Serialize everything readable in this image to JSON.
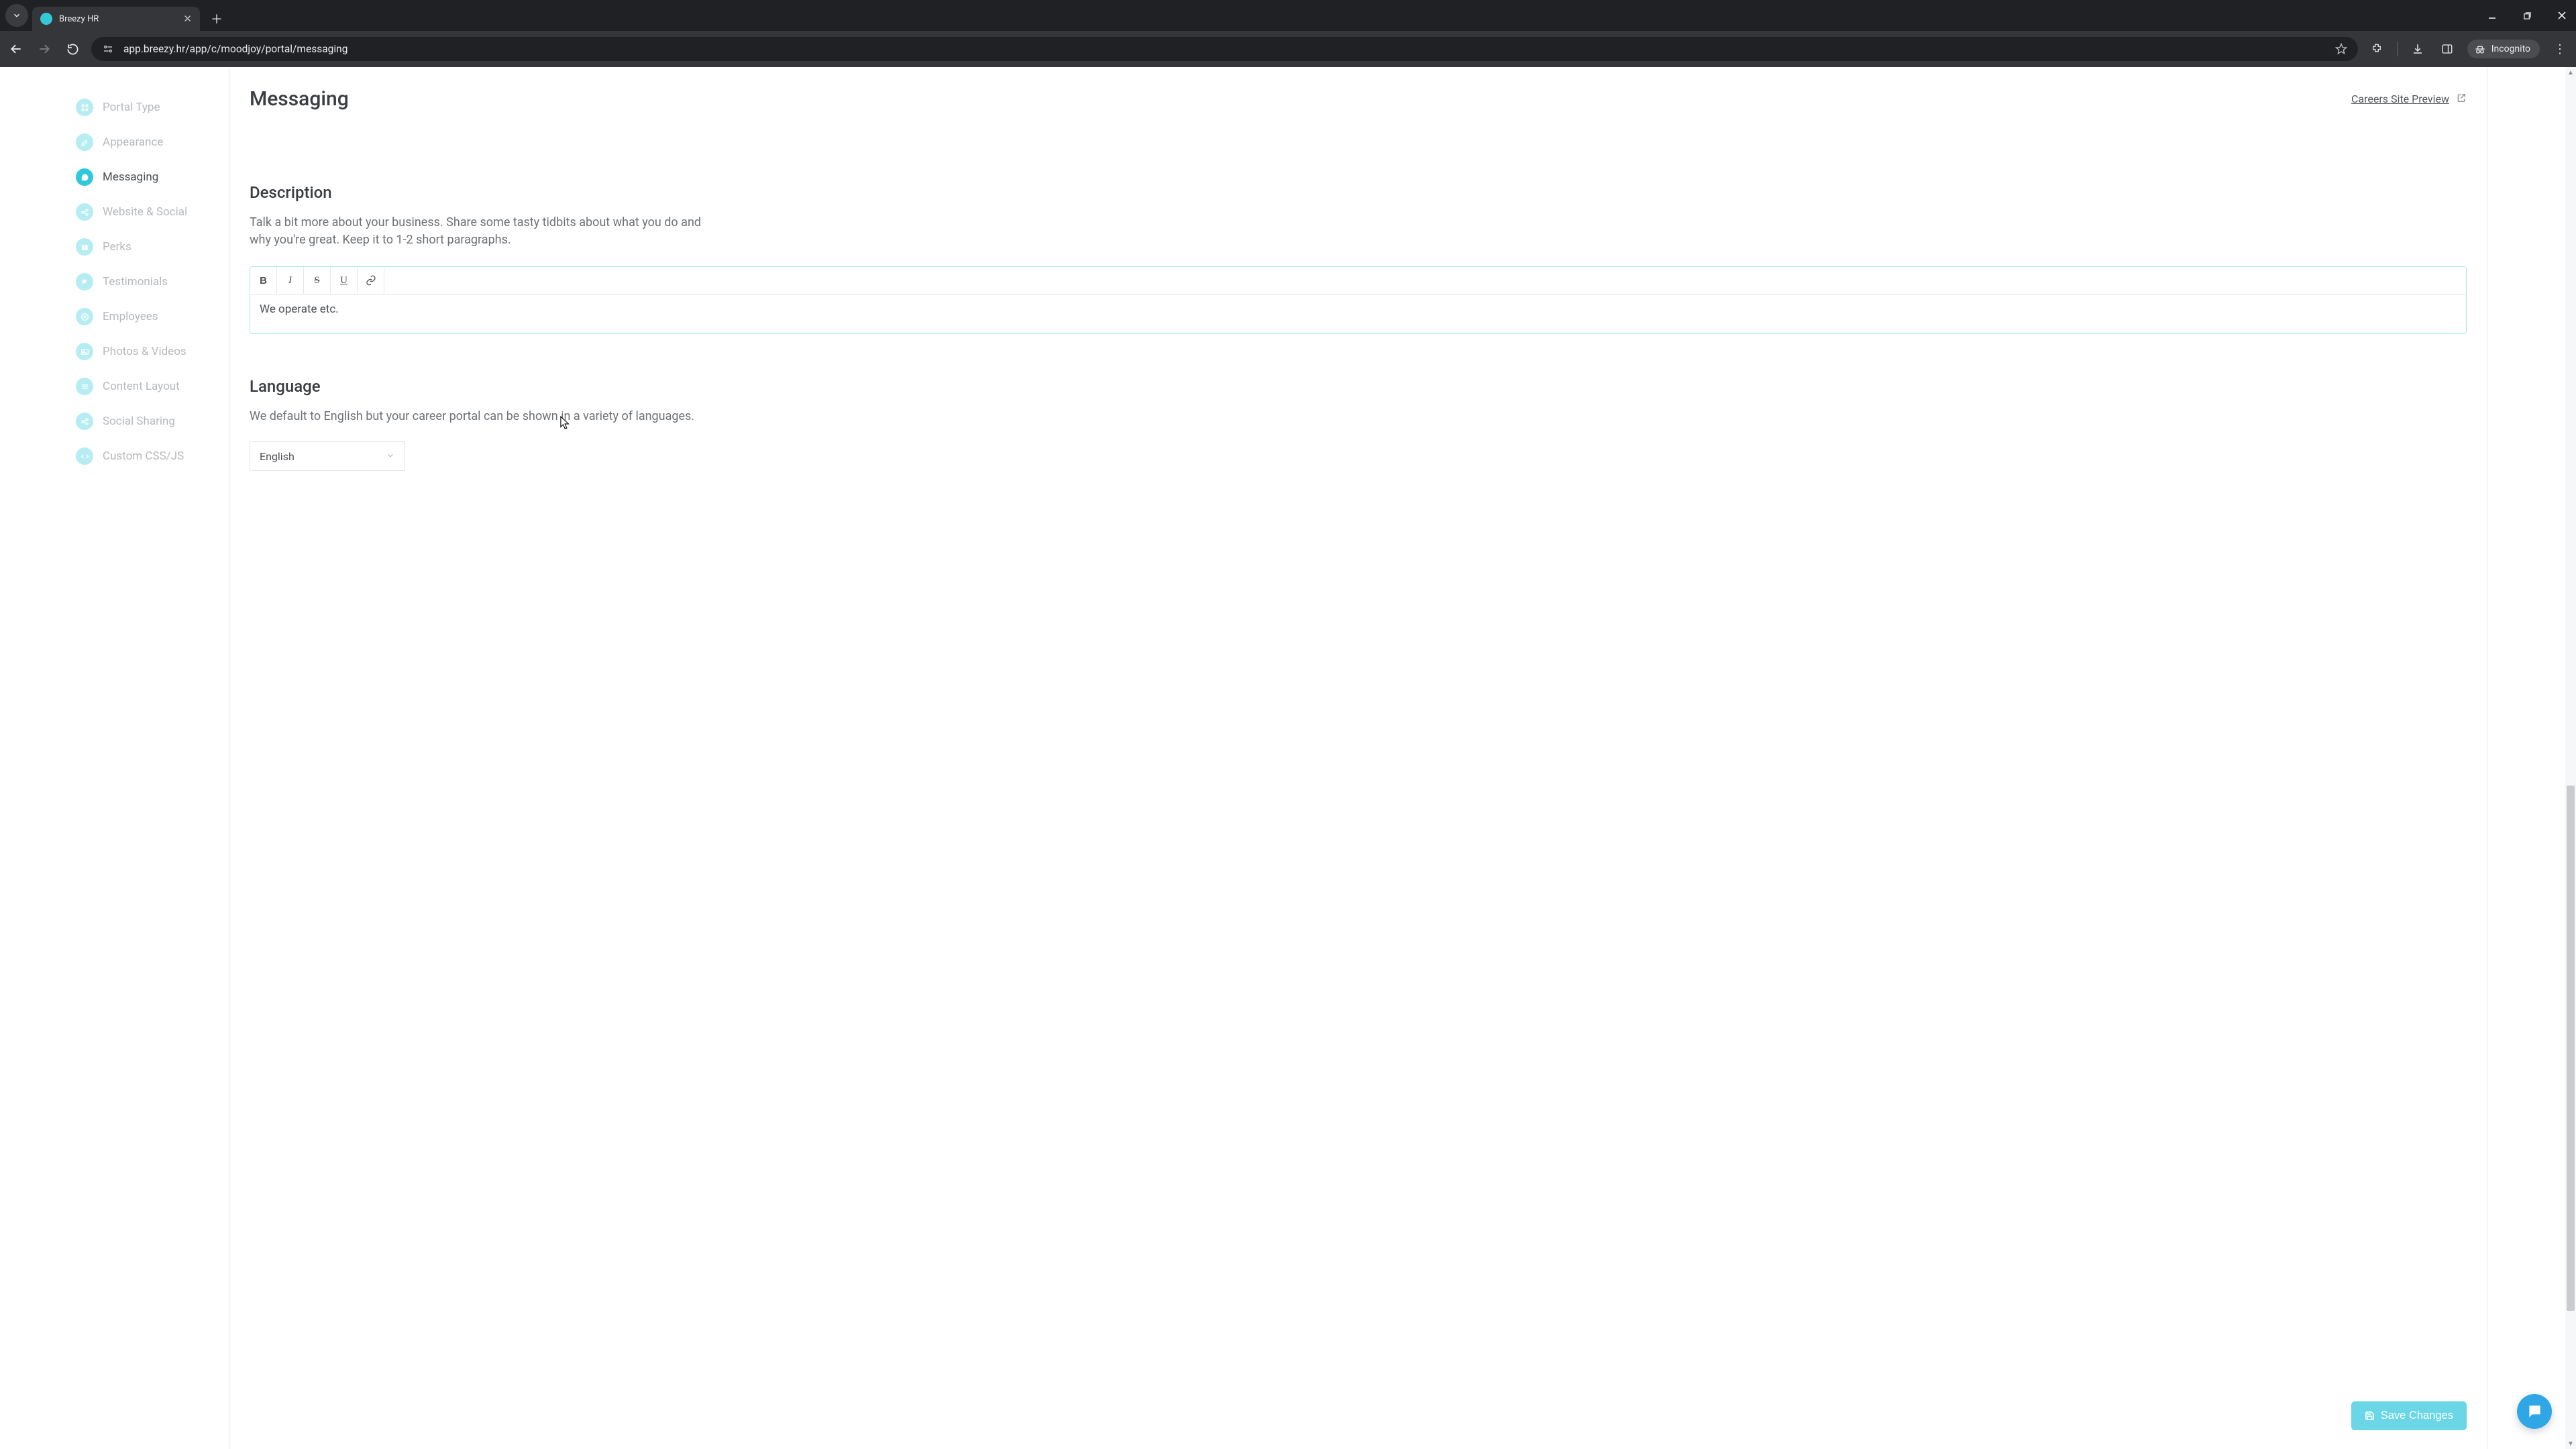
{
  "browser": {
    "tab_title": "Breezy HR",
    "url": "app.breezy.hr/app/c/moodjoy/portal/messaging",
    "incognito_label": "Incognito"
  },
  "sidebar": {
    "items": [
      {
        "label": "Portal Type"
      },
      {
        "label": "Appearance"
      },
      {
        "label": "Messaging"
      },
      {
        "label": "Website & Social"
      },
      {
        "label": "Perks"
      },
      {
        "label": "Testimonials"
      },
      {
        "label": "Employees"
      },
      {
        "label": "Photos & Videos"
      },
      {
        "label": "Content Layout"
      },
      {
        "label": "Social Sharing"
      },
      {
        "label": "Custom CSS/JS"
      }
    ],
    "active_index": 2
  },
  "header": {
    "title": "Messaging",
    "preview_link": "Careers Site Preview"
  },
  "description": {
    "heading": "Description",
    "help": "Talk a bit more about your business. Share some tasty tidbits about what you do and why you're great. Keep it to 1-2 short paragraphs.",
    "toolbar": {
      "bold": "B",
      "italic": "I",
      "strike": "S",
      "underline": "U"
    },
    "value": "We operate etc."
  },
  "language": {
    "heading": "Language",
    "help": "We default to English but your career portal can be shown in a variety of languages.",
    "selected": "English"
  },
  "actions": {
    "save_label": "Save Changes"
  }
}
